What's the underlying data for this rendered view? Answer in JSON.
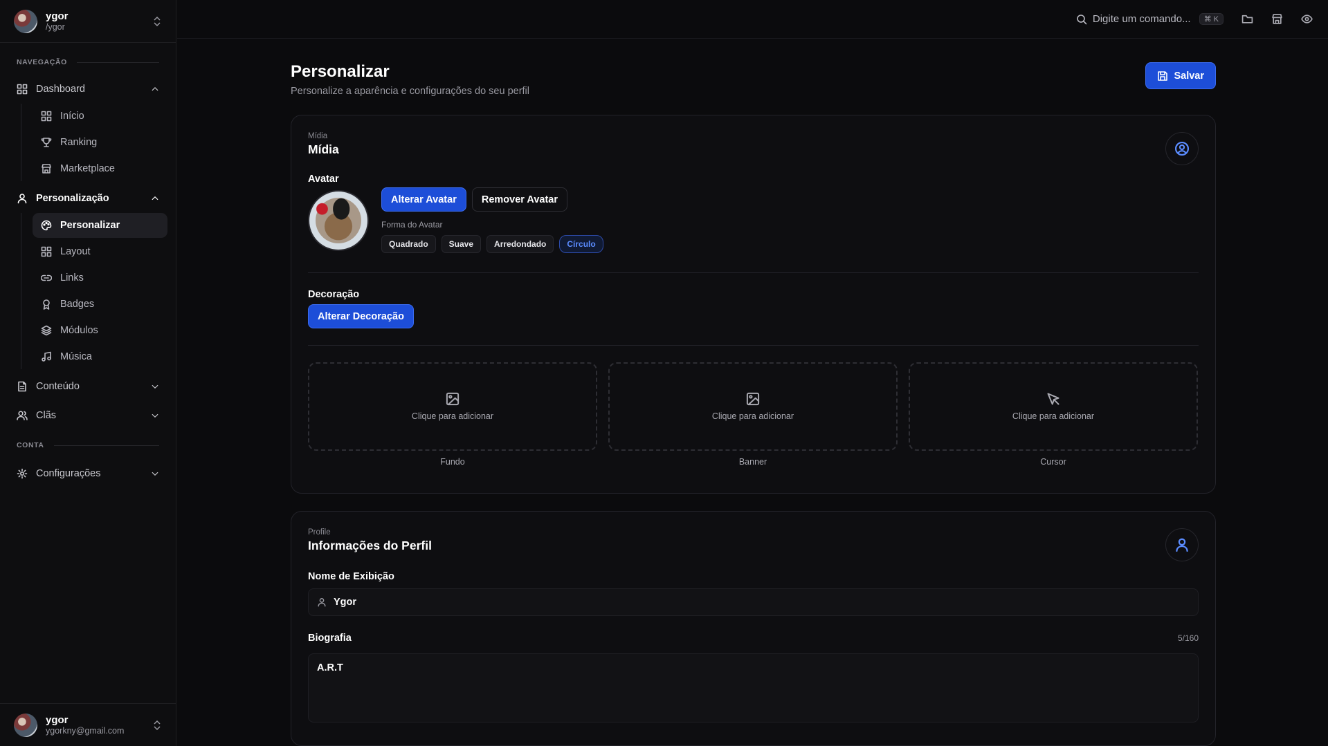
{
  "sidebar": {
    "user": {
      "name": "ygor",
      "handle": "/ygor"
    },
    "sections": {
      "navigation": "NAVEGAÇÃO",
      "account": "CONTA"
    },
    "groups": {
      "dashboard": "Dashboard",
      "personalizacao": "Personalização",
      "conteudo": "Conteúdo",
      "clas": "Clãs",
      "configuracoes": "Configurações"
    },
    "dashboard_items": [
      "Início",
      "Ranking",
      "Marketplace"
    ],
    "personalizacao_items": [
      "Personalizar",
      "Layout",
      "Links",
      "Badges",
      "Módulos",
      "Música"
    ],
    "footer": {
      "name": "ygor",
      "email": "ygorkny@gmail.com"
    }
  },
  "topbar": {
    "command_placeholder": "Digite um comando...",
    "shortcut": "⌘ K"
  },
  "page": {
    "title": "Personalizar",
    "subtitle": "Personalize a aparência e configurações do seu perfil",
    "save_label": "Salvar"
  },
  "media_card": {
    "small": "Mídia",
    "title": "Mídia",
    "avatar_label": "Avatar",
    "change_avatar": "Alterar Avatar",
    "remove_avatar": "Remover Avatar",
    "shape_label": "Forma do Avatar",
    "shapes": [
      "Quadrado",
      "Suave",
      "Arredondado",
      "Círculo"
    ],
    "selected_shape": "Círculo",
    "decoration_label": "Decoração",
    "change_decoration": "Alterar Decoração",
    "drop_text": "Clique para adicionar",
    "slots": [
      "Fundo",
      "Banner",
      "Cursor"
    ]
  },
  "profile_card": {
    "small": "Profile",
    "title": "Informações do Perfil",
    "display_name_label": "Nome de Exibição",
    "display_name_value": "Ygor",
    "bio_label": "Biografia",
    "bio_count": "5/160",
    "bio_value": "A.R.T"
  },
  "colors": {
    "accent": "#1d4ed8",
    "accent_text": "#5b8cff",
    "bg": "#0b0b0d"
  }
}
